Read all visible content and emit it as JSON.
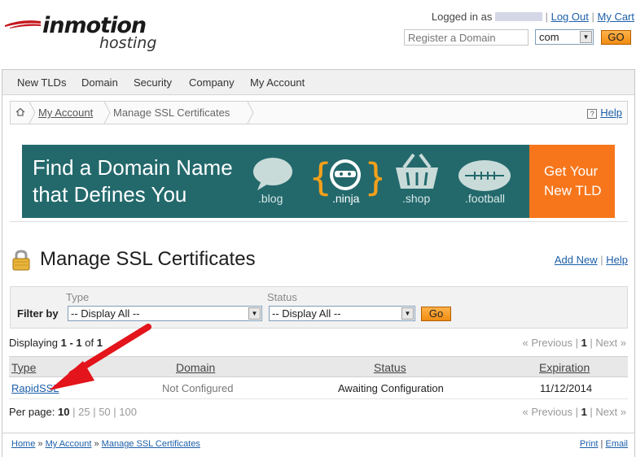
{
  "header": {
    "brand_main": "inmotion",
    "brand_sub": "hosting",
    "logged_in_prefix": "Logged in as",
    "logout": "Log Out",
    "cart": "My Cart",
    "domain_placeholder": "Register a Domain",
    "tld_selected": "com",
    "go_label": "GO"
  },
  "nav": {
    "items": [
      "New TLDs",
      "Domain",
      "Security",
      "Company",
      "My Account"
    ]
  },
  "breadcrumb": {
    "items": [
      "My Account",
      "Manage SSL Certificates"
    ],
    "help": "Help"
  },
  "banner": {
    "headline_line1": "Find a Domain Name",
    "headline_line2": "that Defines You",
    "tlds": [
      ".blog",
      ".ninja",
      ".shop",
      ".football"
    ],
    "cta_line1": "Get Your",
    "cta_line2": "New TLD",
    "colors": {
      "background": "#23696c",
      "cta": "#f7761b",
      "bracket": "#f5a01a"
    }
  },
  "page": {
    "title": "Manage SSL Certificates",
    "add_new": "Add New",
    "help": "Help"
  },
  "filter": {
    "type_label": "Type",
    "status_label": "Status",
    "filter_by": "Filter by",
    "type_value": "-- Display All --",
    "status_value": "-- Display All --",
    "go_label": "Go"
  },
  "listing": {
    "displaying_prefix": "Displaying",
    "range": "1 - 1",
    "of": "of",
    "total": "1",
    "previous": "« Previous",
    "current_page": "1",
    "next": "Next »",
    "columns": [
      "Type",
      "Domain",
      "Status",
      "Expiration"
    ],
    "rows": [
      {
        "type": "RapidSSL",
        "domain": "Not Configured",
        "status": "Awaiting Configuration",
        "expiration": "11/12/2014"
      }
    ]
  },
  "per_page": {
    "label": "Per page:",
    "current": "10",
    "options": [
      "25",
      "50",
      "100"
    ]
  },
  "footer": {
    "crumbs": [
      "Home",
      "My Account",
      "Manage SSL Certificates"
    ],
    "print": "Print",
    "email": "Email"
  }
}
